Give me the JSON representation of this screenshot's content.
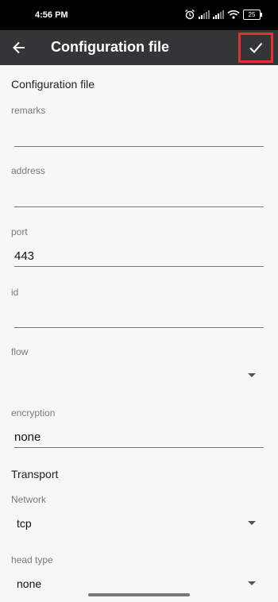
{
  "status": {
    "time": "4:56 PM",
    "battery": "25"
  },
  "appbar": {
    "title": "Configuration file"
  },
  "sections": {
    "config": "Configuration file",
    "transport": "Transport"
  },
  "fields": {
    "remarks": {
      "label": "remarks",
      "value": ""
    },
    "address": {
      "label": "address",
      "value": ""
    },
    "port": {
      "label": "port",
      "value": "443"
    },
    "id": {
      "label": "id",
      "value": ""
    },
    "flow": {
      "label": "flow",
      "value": ""
    },
    "encryption": {
      "label": "encryption",
      "value": "none"
    },
    "network": {
      "label": "Network",
      "value": "tcp"
    },
    "head_type": {
      "label": "head type",
      "value": "none"
    }
  },
  "icons": {
    "back": "back-arrow-icon",
    "save": "check-icon",
    "dropdown": "dropdown-arrow-icon"
  }
}
